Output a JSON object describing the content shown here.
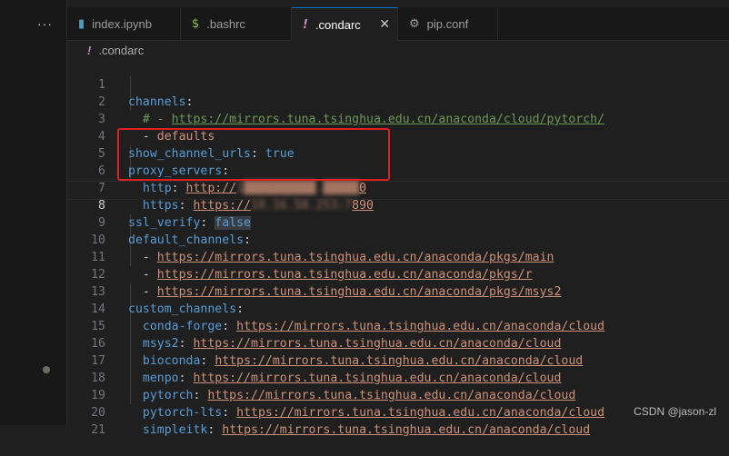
{
  "activity": {
    "more_label": "···"
  },
  "tabs": [
    {
      "label": "index.ipynb",
      "icon": "notebook-icon",
      "icon_color": "#519aba",
      "icon_glyph": "▮"
    },
    {
      "label": ".bashrc",
      "icon": "dollar-icon",
      "icon_color": "#8dc149",
      "icon_glyph": "$"
    },
    {
      "label": ".condarc",
      "icon": "exclamation-icon",
      "icon_color": "#c586c0",
      "icon_glyph": "!",
      "active": true
    },
    {
      "label": "pip.conf",
      "icon": "gear-icon",
      "icon_color": "#9d9d9d",
      "icon_glyph": "⚙"
    }
  ],
  "breadcrumb": {
    "file": ".condarc",
    "icon_glyph": "!"
  },
  "editor": {
    "current_line": 8,
    "lines": [
      {
        "n": "1"
      },
      {
        "n": "2"
      },
      {
        "n": "3"
      },
      {
        "n": "4"
      },
      {
        "n": "5"
      },
      {
        "n": "6"
      },
      {
        "n": "7"
      },
      {
        "n": "8"
      },
      {
        "n": "9"
      },
      {
        "n": "10"
      },
      {
        "n": "11"
      },
      {
        "n": "12"
      },
      {
        "n": "13"
      },
      {
        "n": "14"
      },
      {
        "n": "15"
      },
      {
        "n": "16"
      },
      {
        "n": "17"
      },
      {
        "n": "18"
      },
      {
        "n": "19"
      },
      {
        "n": "20"
      },
      {
        "n": "21"
      }
    ],
    "text": {
      "l1_key": "channels",
      "l2_comment": "# - ",
      "l2_url": "https://mirrors.tuna.tsinghua.edu.cn/anaconda/cloud/pytorch/",
      "l3_dash": "- ",
      "l3_val": "defaults",
      "l4_key": "show_channel_urls",
      "l4_val": "true",
      "l5_key": "proxy_servers",
      "l6_key": "http",
      "l6_val_prefix": "http://",
      "l6_val_blurred": "1██████████.█████",
      "l6_val_suffix": "0",
      "l7_key": "https",
      "l7_val_prefix": "https://",
      "l7_val_blurred": "10.16.58.253:7",
      "l7_val_suffix": "890",
      "l8_key": "ssl_verify",
      "l8_val": "false",
      "l9_key": "default_channels",
      "l10_url": "https://mirrors.tuna.tsinghua.edu.cn/anaconda/pkgs/main",
      "l11_url": "https://mirrors.tuna.tsinghua.edu.cn/anaconda/pkgs/r",
      "l12_url": "https://mirrors.tuna.tsinghua.edu.cn/anaconda/pkgs/msys2",
      "l13_key": "custom_channels",
      "l14_key": "conda-forge",
      "l14_url": "https://mirrors.tuna.tsinghua.edu.cn/anaconda/cloud",
      "l15_key": "msys2",
      "l15_url": "https://mirrors.tuna.tsinghua.edu.cn/anaconda/cloud",
      "l16_key": "bioconda",
      "l16_url": "https://mirrors.tuna.tsinghua.edu.cn/anaconda/cloud",
      "l17_key": "menpo",
      "l17_url": "https://mirrors.tuna.tsinghua.edu.cn/anaconda/cloud",
      "l18_key": "pytorch",
      "l18_url": "https://mirrors.tuna.tsinghua.edu.cn/anaconda/cloud",
      "l19_key": "pytorch-lts",
      "l19_url": "https://mirrors.tuna.tsinghua.edu.cn/anaconda/cloud",
      "l20_key": "simpleitk",
      "l20_url": "https://mirrors.tuna.tsinghua.edu.cn/anaconda/cloud"
    }
  },
  "watermark": "CSDN @jason-zl",
  "colors": {
    "key": "#569cd6",
    "string": "#ce9178",
    "comment": "#6a9955",
    "highlight_box": "#e02020",
    "accent": "#0078d4"
  }
}
